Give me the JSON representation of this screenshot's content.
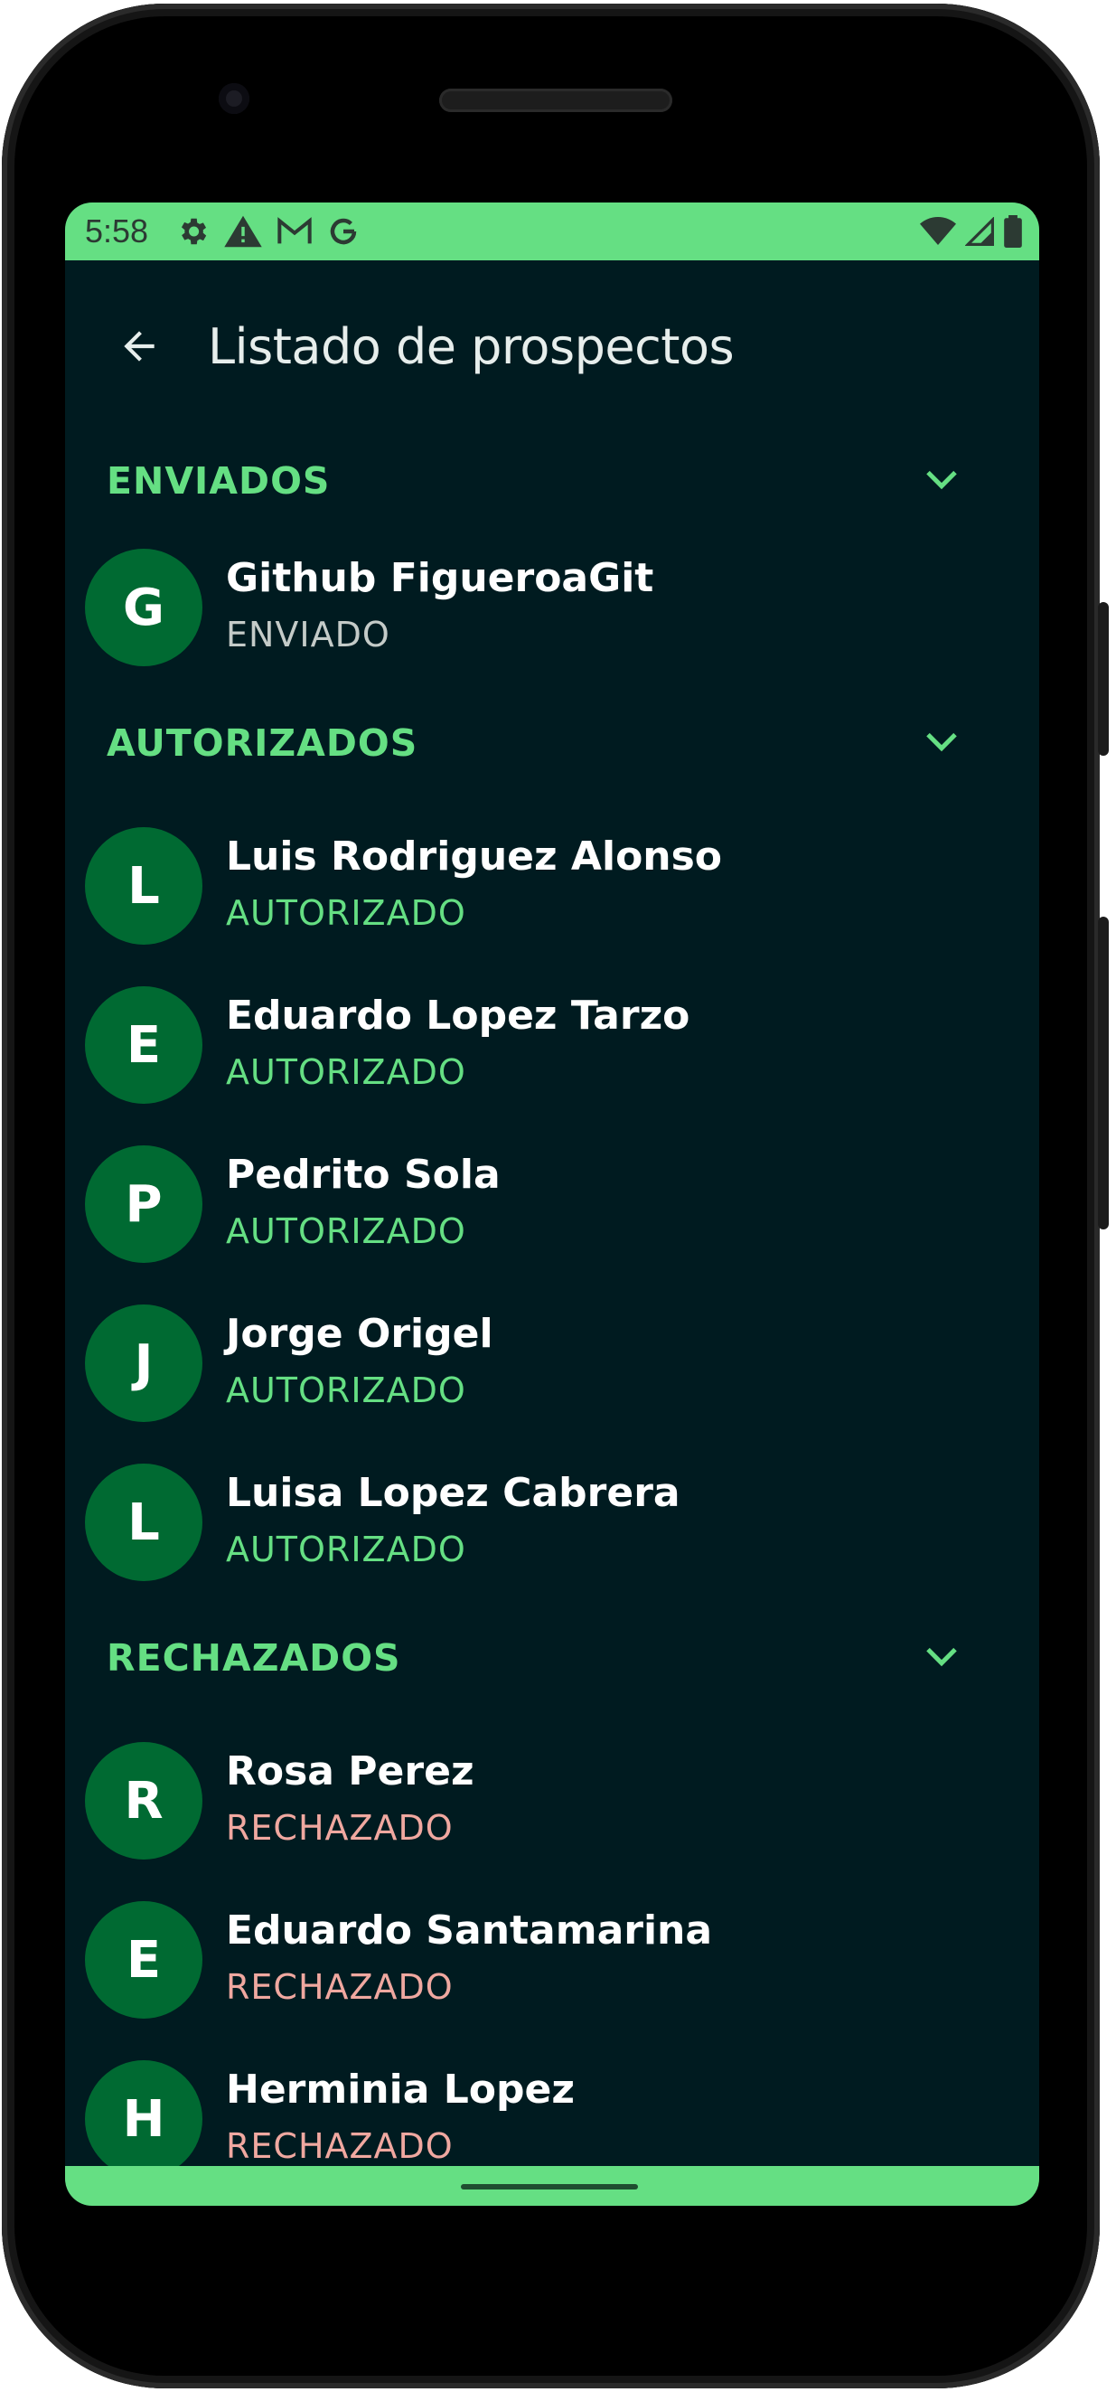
{
  "status_bar": {
    "time": "5:58",
    "left_icons": [
      "gear-icon",
      "warning-icon",
      "gmail-icon",
      "google-icon"
    ],
    "right_icons": [
      "wifi-icon",
      "signal-icon",
      "battery-icon"
    ]
  },
  "app_bar": {
    "back_icon": "arrow-back-icon",
    "title": "Listado de prospectos"
  },
  "colors": {
    "accent": "#65df83",
    "background": "#001b20",
    "avatar": "#006a32",
    "status_sent": "#c4cbc8",
    "status_authorized": "#65df83",
    "status_rejected": "#f0a8a0"
  },
  "sections": {
    "sent": {
      "label": "ENVIADOS",
      "items": [
        {
          "initial": "G",
          "name": "Github FigueroaGit",
          "status": "ENVIADO"
        }
      ]
    },
    "authorized": {
      "label": "AUTORIZADOS",
      "items": [
        {
          "initial": "L",
          "name": "Luis Rodriguez Alonso",
          "status": "AUTORIZADO"
        },
        {
          "initial": "E",
          "name": "Eduardo Lopez Tarzo",
          "status": "AUTORIZADO"
        },
        {
          "initial": "P",
          "name": "Pedrito Sola",
          "status": "AUTORIZADO"
        },
        {
          "initial": "J",
          "name": "Jorge Origel",
          "status": "AUTORIZADO"
        },
        {
          "initial": "L",
          "name": "Luisa Lopez Cabrera",
          "status": "AUTORIZADO"
        }
      ]
    },
    "rejected": {
      "label": "RECHAZADOS",
      "items": [
        {
          "initial": "R",
          "name": "Rosa Perez",
          "status": "RECHAZADO"
        },
        {
          "initial": "E",
          "name": "Eduardo Santamarina",
          "status": "RECHAZADO"
        },
        {
          "initial": "H",
          "name": "Herminia Lopez",
          "status": "RECHAZADO"
        }
      ]
    }
  }
}
